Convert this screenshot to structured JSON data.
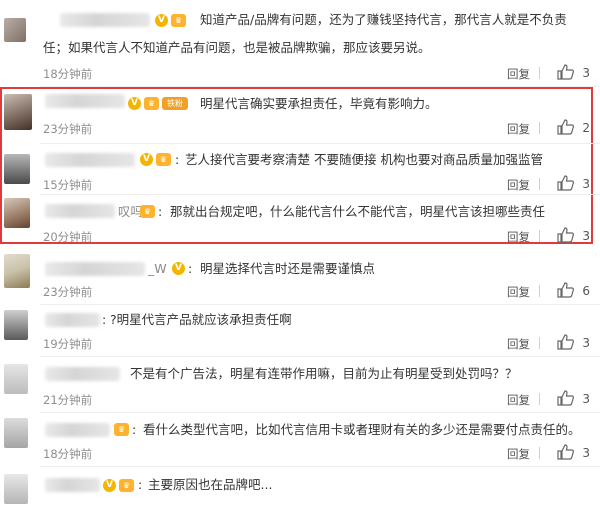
{
  "comments": [
    {
      "part1": "知道产品/品牌有问题，还为了赚钱坚持代言，那代言人就是不负责",
      "part2": "任；如果代言人不知道产品有问题，也是被品牌欺骗，那应该要另说。",
      "time": "18分钟前",
      "reply": "回复",
      "likes": "3"
    },
    {
      "badge": "铁粉",
      "text": "明星代言确实要承担责任，毕竟有影响力。",
      "time": "23分钟前",
      "reply": "回复",
      "likes": "2"
    },
    {
      "text": "艺人接代言要考察清楚 不要随便接 机构也要对商品质量加强监管",
      "time": "15分钟前",
      "reply": "回复",
      "likes": "3"
    },
    {
      "name_tail": "叹吗",
      "text": "那就出台规定吧，什么能代言什么不能代言，明星代言该担哪些责任",
      "time": "20分钟前",
      "reply": "回复",
      "likes": "3"
    },
    {
      "name_tail": "_W",
      "text": "明星选择代言时还是需要谨慎点",
      "time": "23分钟前",
      "reply": "回复",
      "likes": "6"
    },
    {
      "text": "?明星代言产品就应该承担责任啊",
      "time": "19分钟前",
      "reply": "回复",
      "likes": "3"
    },
    {
      "text": "不是有个广告法，明星有连带作用嘛，目前为止有明星受到处罚吗？？",
      "time": "21分钟前",
      "reply": "回复",
      "likes": "3"
    },
    {
      "text": "看什么类型代言吧，比如代言信用卡或者理财有关的多少还是需要付点责任的。",
      "time": "18分钟前",
      "reply": "回复",
      "likes": "3"
    },
    {
      "text": "主要原因也在品牌吧..."
    }
  ],
  "icons": {
    "like": "thumbs-up-icon",
    "verified": "v-badge-icon",
    "fan": "fan-badge-icon"
  },
  "colors": {
    "highlight": "#e03a3a",
    "badge": "#f4b400"
  }
}
